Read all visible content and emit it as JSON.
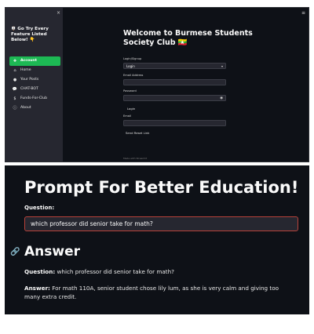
{
  "top": {
    "sidebar": {
      "close": "×",
      "title": "Go Try Every Feature Listed Below!",
      "title_icon": "🪧",
      "title_emoji": "👇",
      "items": [
        {
          "label": "Account",
          "icon": "✚",
          "icon_name": "account-icon",
          "active": true
        },
        {
          "label": "Home",
          "icon": "⌂",
          "icon_name": "home-icon",
          "active": false
        },
        {
          "label": "Your Posts",
          "icon": "●",
          "icon_name": "posts-icon",
          "active": false
        },
        {
          "label": "CHAT-BOT",
          "icon": "💬",
          "icon_name": "chat-icon",
          "active": false
        },
        {
          "label": "Funds-For-Club",
          "icon": "$",
          "icon_name": "dollar-icon",
          "active": false
        },
        {
          "label": "About",
          "icon": "ⓘ",
          "icon_name": "info-icon",
          "active": false
        }
      ],
      "accent_color": "#1db954"
    },
    "menu_icon": "≡",
    "welcome": "Welcome to Burmese Students Society Club 🇲🇲",
    "form": {
      "mode_label": "Login/Signup",
      "mode_value": "Login",
      "email_label": "Email Address",
      "email_value": "",
      "password_label": "Password",
      "password_value": "",
      "login_button": "Login",
      "reset_email_label": "Email",
      "reset_email_value": "",
      "reset_button": "Send Reset Link"
    },
    "footer": "Made with Streamlit"
  },
  "bottom": {
    "title": "Prompt For Better Education!",
    "question_label": "Question:",
    "question_value": "which professor did senior take for math?",
    "answer_heading": "Answer",
    "q_prefix": "Question:",
    "q_text": "which professor did senior take for math?",
    "a_prefix": "Answer:",
    "a_text": "For math 110A, senior student chose lily lum, as she is very calm and giving too many extra credit.",
    "input_border_color": "#b8423a",
    "link_color": "#4a90d9"
  }
}
